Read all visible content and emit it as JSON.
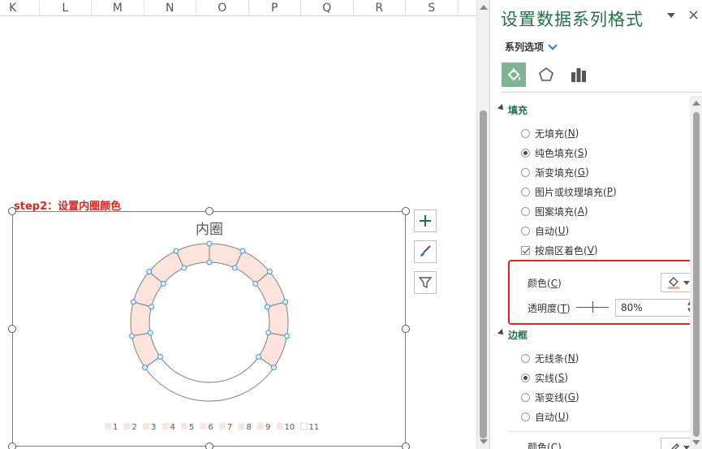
{
  "sheet": {
    "columns": [
      "K",
      "L",
      "M",
      "N",
      "O",
      "P",
      "Q",
      "R",
      "S"
    ],
    "step_label": "step2：设置内圈颜色"
  },
  "chart": {
    "title": "内圈",
    "legend": [
      "1",
      "2",
      "3",
      "4",
      "5",
      "6",
      "7",
      "8",
      "9",
      "10",
      "11"
    ],
    "segment_fill": "#fce4dc",
    "segment_stroke": "#7f7f7f",
    "selection_point_color": "#3a9ad9",
    "side_buttons": [
      "plus-icon",
      "brush-icon",
      "filter-icon"
    ]
  },
  "pane": {
    "title": "设置数据系列格式",
    "series_options": "系列选项",
    "tabs": [
      "fill-line-icon",
      "effects-icon",
      "series-options-icon"
    ],
    "fill_section": {
      "header": "填充",
      "options": [
        {
          "label": "无填充(",
          "key": "N",
          "selected": false
        },
        {
          "label": "纯色填充(",
          "key": "S",
          "selected": true
        },
        {
          "label": "渐变填充(",
          "key": "G",
          "selected": false
        },
        {
          "label": "图片或纹理填充(",
          "key": "P",
          "selected": false
        },
        {
          "label": "图案填充(",
          "key": "A",
          "selected": false
        },
        {
          "label": "自动(",
          "key": "U",
          "selected": false
        }
      ],
      "vary_colors": {
        "label": "按扇区着色(",
        "key": "V",
        "checked": true
      },
      "color_label": "颜色(",
      "color_key": "C",
      "transparency_label": "透明度(",
      "transparency_key": "T",
      "transparency_value": "80%",
      "swatch_color": "#f4b183"
    },
    "border_section": {
      "header": "边框",
      "options": [
        {
          "label": "无线条(",
          "key": "N",
          "selected": false
        },
        {
          "label": "实线(",
          "key": "S",
          "selected": true
        },
        {
          "label": "渐变线(",
          "key": "G",
          "selected": false
        },
        {
          "label": "自动(",
          "key": "U",
          "selected": false
        }
      ],
      "color_label": "颜色(",
      "color_key": "C"
    }
  }
}
